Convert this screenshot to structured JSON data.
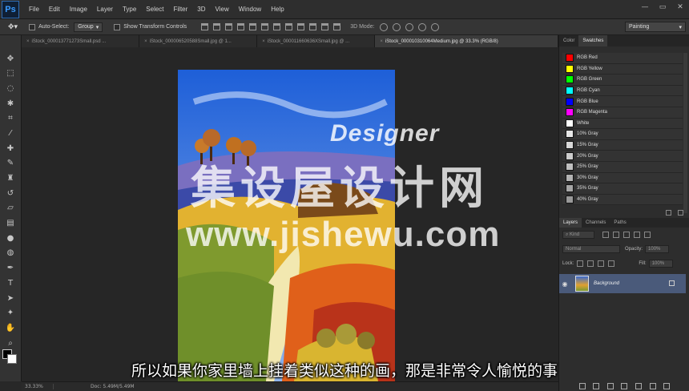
{
  "app": {
    "logo": "Ps"
  },
  "menu": [
    "File",
    "Edit",
    "Image",
    "Layer",
    "Type",
    "Select",
    "Filter",
    "3D",
    "View",
    "Window",
    "Help"
  ],
  "window_controls": [
    "—",
    "▭",
    "✕"
  ],
  "options": {
    "auto_select_label": "Auto-Select:",
    "auto_select_value": "Group",
    "transform_label": "Show Transform Controls",
    "mode_3d_label": "3D Mode:",
    "workspace": "Painting"
  },
  "tabs": [
    {
      "label": "iStock_000013771273Small.psd ..."
    },
    {
      "label": "iStock_000006520588Small.jpg @ 1..."
    },
    {
      "label": "iStock_000011660636XSmall.jpg @ ..."
    },
    {
      "label": "iStock_000010310064Medium.jpg @ 33.3% (RGB/8)"
    }
  ],
  "status": {
    "zoom": "33.33%",
    "doc": "Doc: 5.49M/5.49M"
  },
  "swatches_panel": {
    "tabs": [
      "Color",
      "Swatches"
    ],
    "items": [
      {
        "name": "RGB Red",
        "color": "#ff0000"
      },
      {
        "name": "RGB Yellow",
        "color": "#ffff00"
      },
      {
        "name": "RGB Green",
        "color": "#00ff00"
      },
      {
        "name": "RGB Cyan",
        "color": "#00ffff"
      },
      {
        "name": "RGB Blue",
        "color": "#0000ff"
      },
      {
        "name": "RGB Magenta",
        "color": "#ff00ff"
      },
      {
        "name": "White",
        "color": "#ffffff"
      },
      {
        "name": "10% Gray",
        "color": "#e6e6e6"
      },
      {
        "name": "15% Gray",
        "color": "#d9d9d9"
      },
      {
        "name": "20% Gray",
        "color": "#cccccc"
      },
      {
        "name": "25% Gray",
        "color": "#bfbfbf"
      },
      {
        "name": "30% Gray",
        "color": "#b3b3b3"
      },
      {
        "name": "35% Gray",
        "color": "#a6a6a6"
      },
      {
        "name": "40% Gray",
        "color": "#999999"
      }
    ]
  },
  "layers_panel": {
    "tabs": [
      "Layers",
      "Channels",
      "Paths"
    ],
    "filter_kind": "Kind",
    "blend_mode": "Normal",
    "opacity_label": "Opacity:",
    "opacity_value": "100%",
    "lock_label": "Lock:",
    "fill_label": "Fill:",
    "fill_value": "100%",
    "layer_name": "Background"
  },
  "watermark": {
    "brand": "Designer",
    "cn_name": "集设屋设计网",
    "url": "www.jishewu.com"
  },
  "subtitle": "所以如果你家里墙上挂着类似这种的画，那是非常令人愉悦的事"
}
